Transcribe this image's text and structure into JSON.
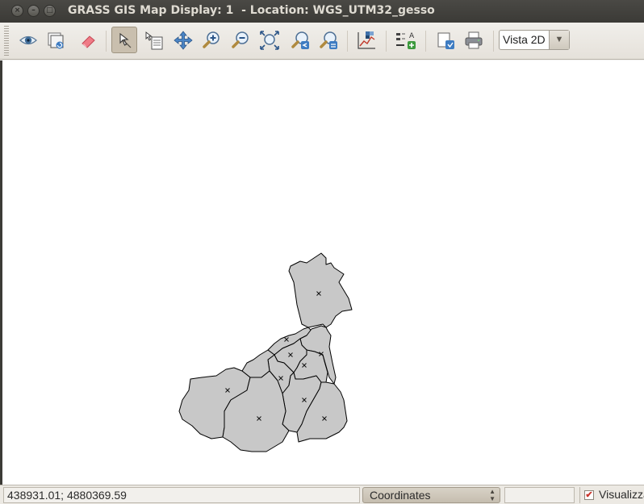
{
  "window": {
    "title": "GRASS GIS Map Display: 1  - Location: WGS_UTM32_gesso",
    "close_glyph": "×",
    "minimize_glyph": "–",
    "maximize_glyph": "□"
  },
  "toolbar": {
    "tools": [
      {
        "name": "display-map-icon"
      },
      {
        "name": "render-map-icon"
      },
      {
        "name": "erase-display-icon"
      },
      {
        "name": "pointer-icon",
        "active": true
      },
      {
        "name": "query-icon"
      },
      {
        "name": "pan-icon"
      },
      {
        "name": "zoom-in-icon"
      },
      {
        "name": "zoom-out-icon"
      },
      {
        "name": "zoom-extent-icon"
      },
      {
        "name": "zoom-back-icon"
      },
      {
        "name": "zoom-menu-icon"
      },
      {
        "name": "analyze-icon"
      },
      {
        "name": "decoration-icon"
      },
      {
        "name": "save-image-icon"
      },
      {
        "name": "print-icon"
      }
    ],
    "view_mode": "Vista 2D"
  },
  "statusbar": {
    "coordinates": "438931.01; 4880369.59",
    "mode": "Coordinates",
    "render_label": "Visualizza",
    "render_checked": true
  },
  "colors": {
    "polygon_fill": "#c8c8c8",
    "polygon_stroke": "#000000",
    "title_bg": "#3c3b37"
  }
}
